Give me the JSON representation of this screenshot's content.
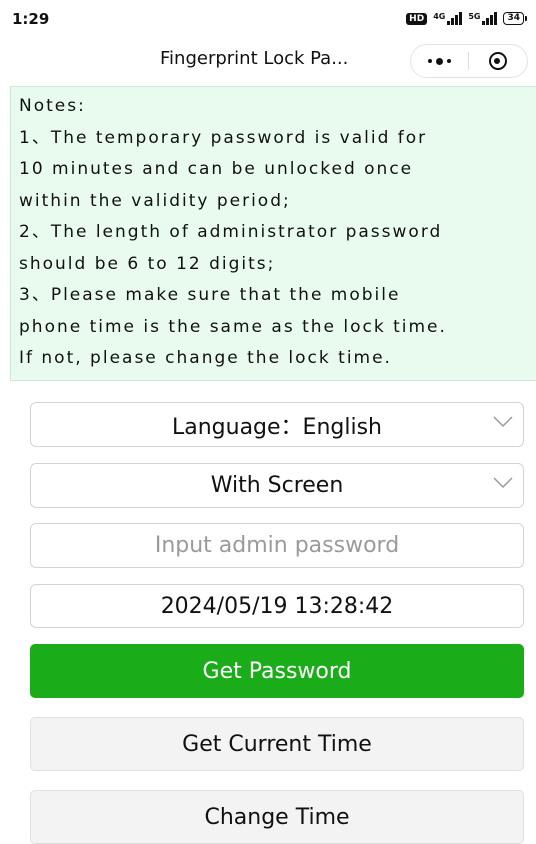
{
  "status_bar": {
    "time": "1:29",
    "hd_badge": "HD",
    "signal1_label": "4G",
    "signal2_label": "5G",
    "battery": "34"
  },
  "header": {
    "title": "Fingerprint Lock Pa...",
    "more_icon": "more-dots-icon",
    "close_icon": "target-circle-icon"
  },
  "notes": {
    "lines": [
      "Notes:",
      "1、The temporary password is valid for",
      "10 minutes and can be unlocked once",
      "within the validity period;",
      "2、The length of administrator password",
      "should be 6 to 12 digits;",
      "3、Please make sure that the mobile",
      "phone time is the same as the lock time.",
      "If not, please change the lock time."
    ]
  },
  "form": {
    "language_select": "Language：English",
    "screen_select": "With Screen",
    "password_placeholder": "Input admin password",
    "password_value": "",
    "datetime": "2024/05/19 13:28:42"
  },
  "buttons": {
    "get_password": "Get Password",
    "get_current_time": "Get Current Time",
    "change_time": "Change Time"
  },
  "colors": {
    "primary_green": "#1aad19",
    "notes_background": "#e9fbef",
    "secondary_button": "#f3f3f3"
  }
}
